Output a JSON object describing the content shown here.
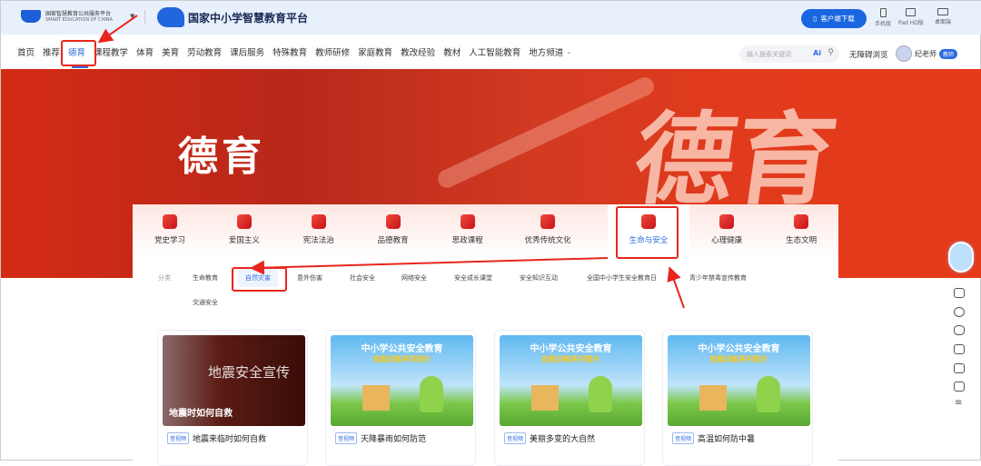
{
  "header": {
    "org_logo_cn": "国家智慧教育公共服务平台",
    "org_logo_en": "SMART EDUCATION OF CHINA",
    "platform_title": "国家中小学智慧教育平台",
    "download_button": "客户端下载",
    "devices": [
      "手机版",
      "Pad HD版",
      "桌面端"
    ]
  },
  "nav": {
    "items": [
      "首页",
      "推荐",
      "德育",
      "课程教学",
      "体育",
      "美育",
      "劳动教育",
      "课后服务",
      "特殊教育",
      "教师研修",
      "家庭教育",
      "教改经验",
      "教材",
      "人工智能教育",
      "地方频道"
    ],
    "active": "德育",
    "search_placeholder": "输入搜索关键词",
    "ai_label": "Ai",
    "accessibility": "无障碍浏览",
    "user_name": "纪老师",
    "user_badge": "教师"
  },
  "banner": {
    "title": "德育",
    "art_text": "德育"
  },
  "categories": {
    "items": [
      "党史学习",
      "爱国主义",
      "宪法法治",
      "品德教育",
      "思政课程",
      "优秀传统文化",
      "生命与安全",
      "心理健康",
      "生态文明"
    ],
    "active": "生命与安全"
  },
  "subcategories": {
    "label": "分类",
    "items": [
      "生命教育",
      "自然灾害",
      "意外伤害",
      "社会安全",
      "网络安全",
      "安全成长课堂",
      "安全知识互动",
      "全国中小学生安全教育日",
      "青少年禁毒宣传教育",
      "交通安全"
    ],
    "active": "自然灾害"
  },
  "cards": [
    {
      "tag": "音视频",
      "title": "地震来临时如何自救",
      "thumb_text": "地震安全宣传",
      "thumb_caption": "地震时如何自救"
    },
    {
      "tag": "音视频",
      "title": "天降暴雨如何防范",
      "thumb_text": "中小学公共安全教育",
      "thumb_caption": "技能训练系列短片"
    },
    {
      "tag": "音视频",
      "title": "美丽多变的大自然",
      "thumb_text": "中小学公共安全教育",
      "thumb_caption": "技能训练系列短片"
    },
    {
      "tag": "音视频",
      "title": "高温如何防中暑",
      "thumb_text": "中小学公共安全教育",
      "thumb_caption": "技能训练系列短片"
    }
  ],
  "colors": {
    "accent": "#2d6be0",
    "banner_red": "#d42a14",
    "annotation": "#e8261c"
  }
}
